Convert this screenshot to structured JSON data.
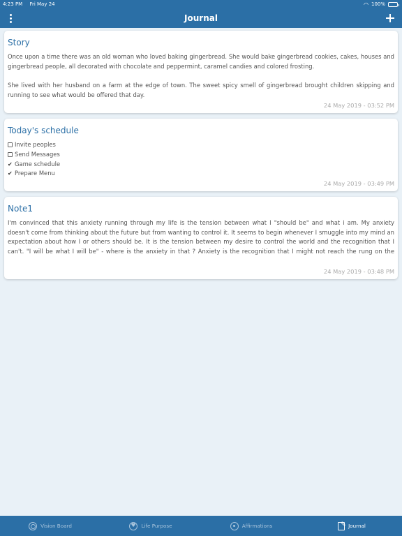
{
  "status": {
    "time": "4:23 PM",
    "date": "Fri May 24",
    "battery": "100%"
  },
  "header": {
    "title": "Journal"
  },
  "entries": [
    {
      "title": "Story",
      "paragraphs": [
        "Once upon a time there was an old woman who loved baking gingerbread. She would bake gingerbread cookies, cakes, houses and gingerbread people, all decorated with chocolate and peppermint, caramel candies and colored frosting.",
        "She lived with her husband on a farm at the edge of town. The sweet spicy smell of gingerbread brought children skipping and running to see what would be offered that day."
      ],
      "date": "24 May 2019 - 03:52 PM"
    },
    {
      "title": "Today's schedule",
      "checklist": [
        {
          "label": "Invite peoples",
          "checked": false
        },
        {
          "label": "Send Messages",
          "checked": false
        },
        {
          "label": "Game schedule",
          "checked": true
        },
        {
          "label": "Prepare Menu",
          "checked": true
        }
      ],
      "date": "24 May 2019 - 03:49 PM"
    },
    {
      "title": "Note1",
      "text": "I'm convinced that this anxiety running through my life is the tension between what I \"should be\" and what i am. My anxiety doesn't come from thinking about the future but from wanting to control it. It seems to begin whenever I smuggle into my mind an expectation about how I or others should be. It is the tension between my desire to control the world and the recognition that I can't. \"I will be what I will be\" - where is the anxiety in that ? Anxiety is the recognition that I might not reach the rung on the opinion ladder I have just set for my self. I fear death most when I am about to exceed what I believe others think of me; then death threatens to c...",
      "date": "24 May 2019 - 03:48 PM"
    }
  ],
  "tabs": [
    {
      "label": "Vision Board",
      "icon": "vision-board-icon",
      "active": false
    },
    {
      "label": "Life Purpose",
      "icon": "heart-icon",
      "active": false
    },
    {
      "label": "Affirmations",
      "icon": "affirmations-icon",
      "active": false
    },
    {
      "label": "Journal",
      "icon": "journal-icon",
      "active": true
    }
  ],
  "colors": {
    "accent": "#2b6fa6",
    "background": "#e9f1f7"
  }
}
